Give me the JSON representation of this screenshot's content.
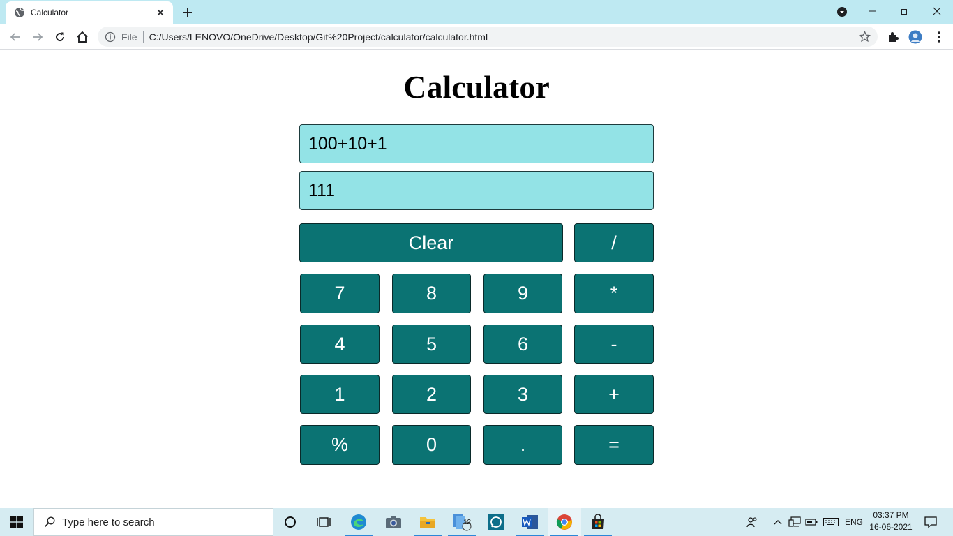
{
  "browser": {
    "tab_title": "Calculator",
    "omnibox_scheme": "File",
    "url": "C:/Users/LENOVO/OneDrive/Desktop/Git%20Project/calculator/calculator.html"
  },
  "page": {
    "title": "Calculator",
    "expression": "100+10+1",
    "result": "111"
  },
  "calculator": {
    "clear_label": "Clear",
    "keys": {
      "divide": "/",
      "multiply": "*",
      "subtract": "-",
      "add": "+",
      "equals": "=",
      "percent": "%",
      "decimal": ".",
      "d0": "0",
      "d1": "1",
      "d2": "2",
      "d3": "3",
      "d4": "4",
      "d5": "5",
      "d6": "6",
      "d7": "7",
      "d8": "8",
      "d9": "9"
    }
  },
  "taskbar": {
    "search_placeholder": "Type here to search",
    "file_explorer_badge": "12",
    "language": "ENG",
    "time": "03:37 PM",
    "date": "16-06-2021"
  },
  "colors": {
    "tabstrip_bg": "#bee9f2",
    "display_bg": "#93e3e6",
    "button_bg": "#0b7373",
    "button_text": "#ffffff",
    "taskbar_bg": "#d6ecf2"
  }
}
